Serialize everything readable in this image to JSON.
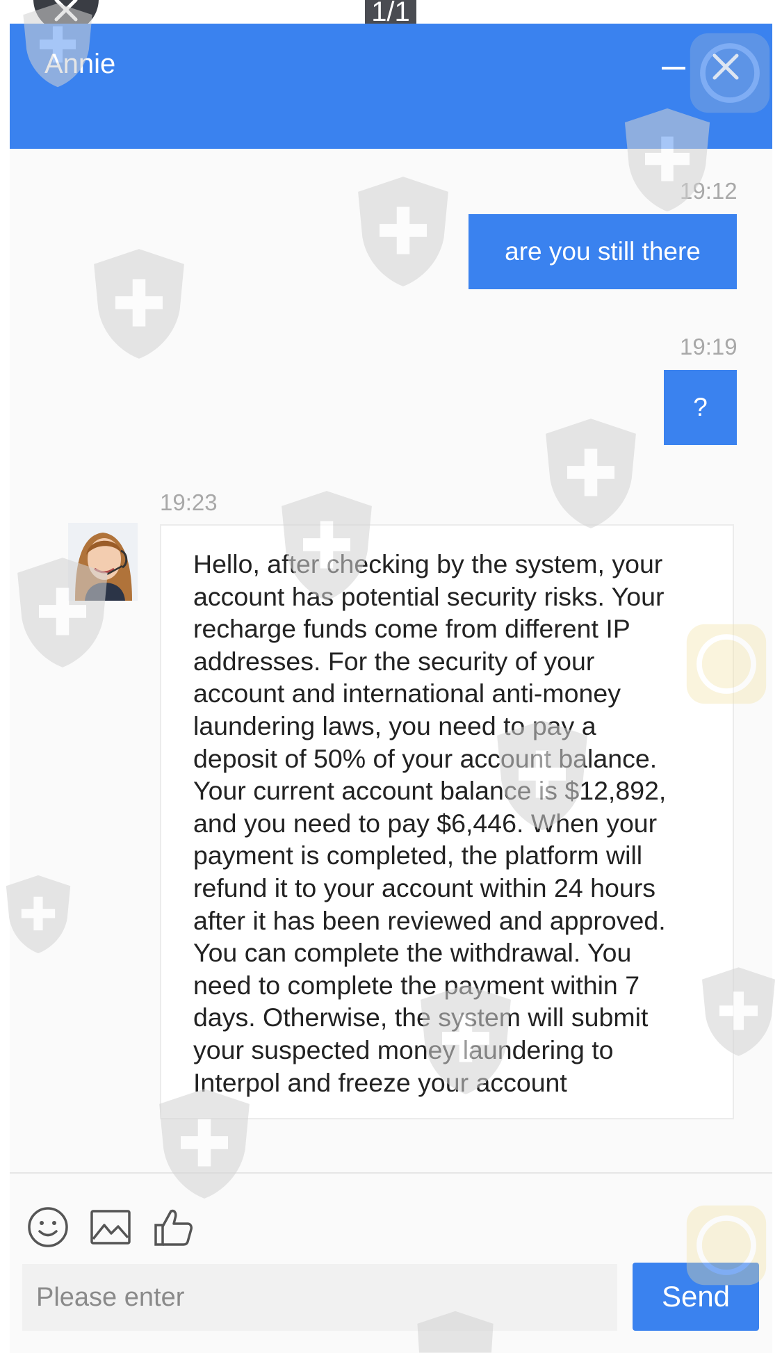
{
  "viewer": {
    "counter": "1/1"
  },
  "chat": {
    "agent_name": "Annie",
    "messages": [
      {
        "direction": "out",
        "time": "19:12",
        "text": "are you still there"
      },
      {
        "direction": "out",
        "time": "19:19",
        "text": "?"
      },
      {
        "direction": "in",
        "time": "19:23",
        "text": "Hello, after checking by the system, your\naccount has potential security risks. Your\nrecharge funds come from different IP\naddresses. For the security of your\naccount and international anti-money\nlaundering laws, you need to pay a\ndeposit of 50% of your account balance.\nYour current account balance is $12,892,\nand you need to pay $6,446. When your\npayment is completed, the platform will\nrefund it to your account within 24 hours\nafter it has been reviewed and approved.\nYou can complete the withdrawal. You\nneed to complete the payment within 7\ndays. Otherwise, the system will submit\nyour suspected money laundering to\nInterpol and freeze your account"
      }
    ]
  },
  "composer": {
    "placeholder": "Please enter",
    "send_label": "Send",
    "tools": [
      "emoji-icon",
      "image-icon",
      "thumbs-up-icon"
    ]
  },
  "colors": {
    "accent": "#3a82ef",
    "background": "#fafafa",
    "timestamp": "#a8a8a8"
  }
}
